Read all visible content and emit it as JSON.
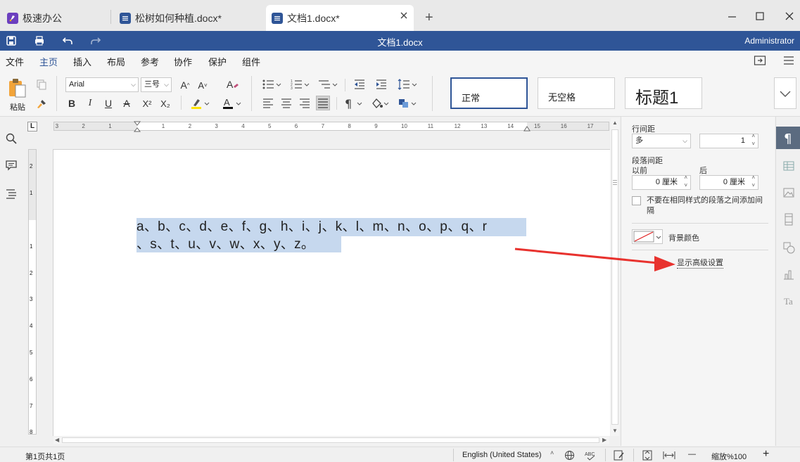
{
  "tabs": {
    "app": "极速办公",
    "doc1": "松树如何种植.docx*",
    "doc2": "文档1.docx*",
    "new_tab": "+"
  },
  "titlebar": {
    "document": "文档1.docx",
    "user": "Administrator"
  },
  "menu": {
    "file": "文件",
    "home": "主页",
    "insert": "插入",
    "layout": "布局",
    "references": "参考",
    "collaborate": "协作",
    "protect": "保护",
    "plugins": "组件"
  },
  "ribbon": {
    "paste_label": "粘贴",
    "font_name": "Arial",
    "font_size": "三号",
    "bold": "B",
    "italic": "I",
    "underline": "U",
    "strike": "A",
    "superscript": "X²",
    "subscript": "X₂",
    "font_grow": "A^",
    "font_shrink": "A˅",
    "styles": {
      "normal": "正常",
      "no_spacing": "无空格",
      "heading1": "标题1"
    }
  },
  "document": {
    "line1": "a、b、c、d、e、f、g、h、i、j、k、l、m、n、o、p、q、r",
    "line2": "、s、t、u、v、w、x、y、z。"
  },
  "paragraph_panel": {
    "line_spacing_title": "行间距",
    "line_spacing_mode": "多",
    "line_spacing_value": "1",
    "para_spacing_title": "段落间距",
    "before_label": "以前",
    "after_label": "后",
    "before_value": "0 厘米",
    "after_value": "0 厘米",
    "no_space_checkbox": "不要在相同样式的段落之间添加间隔",
    "background_color": "背景颜色",
    "advanced_link": "显示高级设置"
  },
  "ruler_h": [
    "3",
    "2",
    "1",
    "1",
    "2",
    "3",
    "4",
    "5",
    "6",
    "7",
    "8",
    "9",
    "10",
    "11",
    "12",
    "13",
    "14",
    "15",
    "16",
    "17"
  ],
  "ruler_v": [
    "2",
    "1",
    "1",
    "2",
    "3",
    "4",
    "5",
    "6",
    "7",
    "8"
  ],
  "status": {
    "page_info": "第1页共1页",
    "language": "English (United States)",
    "zoom": "缩放%100",
    "minus": "—",
    "plus": "+"
  },
  "colors": {
    "brand": "#2f5597",
    "selection": "#c6d8ee",
    "arrow": "#e8322e"
  }
}
